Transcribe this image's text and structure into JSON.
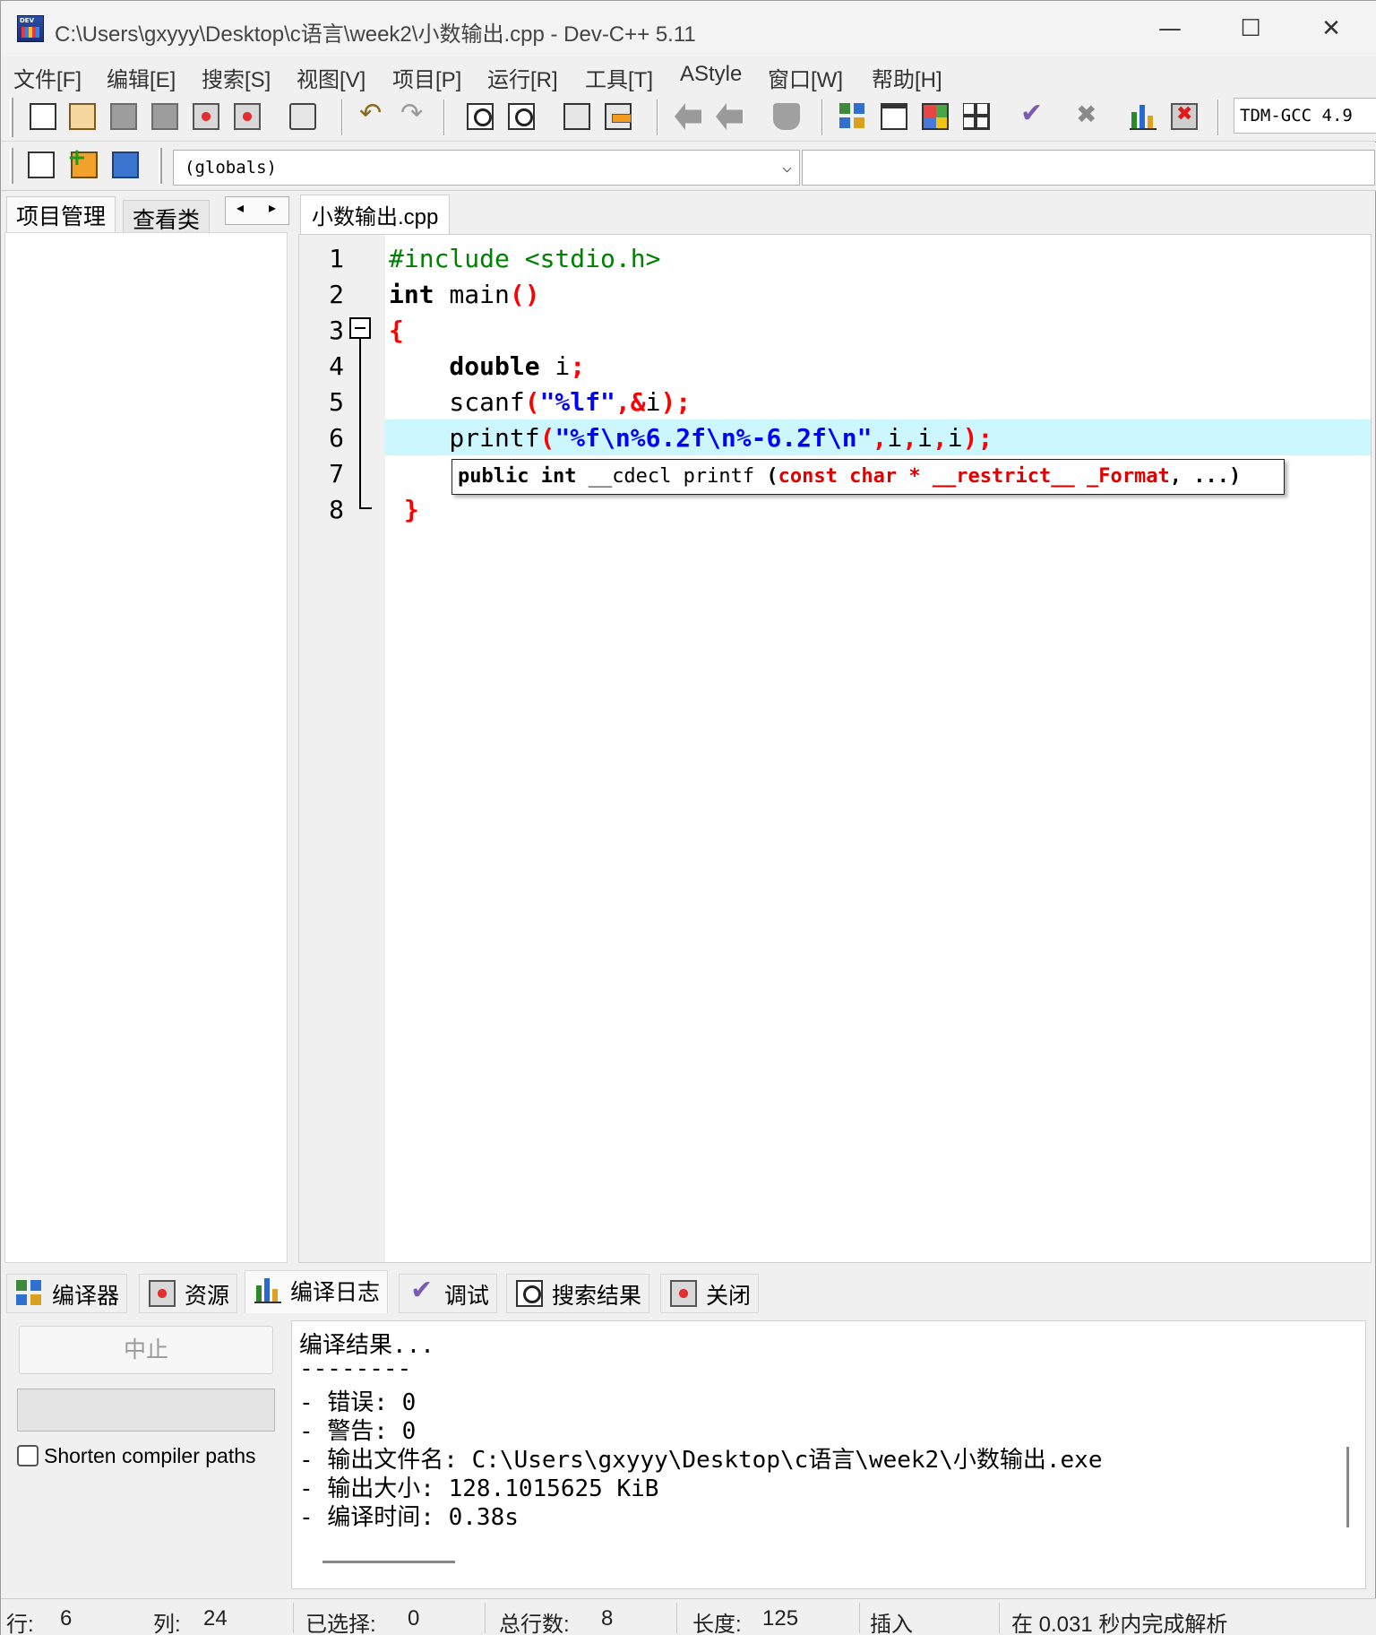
{
  "window": {
    "title": "C:\\Users\\gxyyy\\Desktop\\c语言\\week2\\小数输出.cpp - Dev-C++ 5.11",
    "minimize": "—",
    "maximize": "☐",
    "close": "✕"
  },
  "menu": [
    "文件[F]",
    "编辑[E]",
    "搜索[S]",
    "视图[V]",
    "项目[P]",
    "运行[R]",
    "工具[T]",
    "AStyle",
    "窗口[W]",
    "帮助[H]"
  ],
  "toolbar": {
    "compiler": "TDM-GCC 4.9",
    "globals": "(globals)",
    "combo_arrow": "⌵"
  },
  "left_tabs": [
    "项目管理",
    "查看类"
  ],
  "nav": {
    "prev": "◂",
    "next": "▸"
  },
  "editor": {
    "file_tab": "小数输出.cpp",
    "line_numbers": [
      "1",
      "2",
      "3",
      "4",
      "5",
      "6",
      "7",
      "8"
    ],
    "lines": {
      "l1": "#include <stdio.h>",
      "l2_kw": "int",
      "l2_id": " main",
      "l2_sym": "()",
      "l3_sym": "{",
      "l4_kw": "    double",
      "l4_id": " i",
      "l4_sym": ";",
      "l5_id": "    scanf",
      "l5_sym1": "(",
      "l5_str": "\"%lf\"",
      "l5_sym2": ",&",
      "l5_id2": "i",
      "l5_sym3": ");",
      "l6_id": "    printf",
      "l6_sym1": "(",
      "l6_str": "\"%f\\n%6.2f\\n%-6.2f\\n\"",
      "l6_sym2": ",",
      "l6_id2": "i",
      "l6_sym3": ",",
      "l6_id3": "i",
      "l6_sym4": ",",
      "l6_id4": "i",
      "l6_sym5": ");",
      "l8_sym": " }"
    },
    "tooltip": {
      "kw1": "public int",
      "plain1": " __cdecl printf ",
      "paren1": "(",
      "red1": "const char * __restrict__ _Format",
      "rest": ", ...)"
    }
  },
  "bottom_tabs": [
    "编译器",
    "资源",
    "编译日志",
    "调试",
    "搜索结果",
    "关闭"
  ],
  "bottom_panel": {
    "stop_button": "中止",
    "shorten_label": "Shorten compiler paths",
    "log_lines": [
      "编译结果...",
      "--------",
      "- 错误: 0",
      "- 警告: 0",
      "- 输出文件名: C:\\Users\\gxyyy\\Desktop\\c语言\\week2\\小数输出.exe",
      "- 输出大小: 128.1015625 KiB",
      "- 编译时间: 0.38s"
    ]
  },
  "status": {
    "row_label": "行:",
    "row_value": "6",
    "col_label": "列:",
    "col_value": "24",
    "sel_label": "已选择:",
    "sel_value": "0",
    "total_label": "总行数:",
    "total_value": "8",
    "len_label": "长度:",
    "len_value": "125",
    "mode": "插入",
    "parse": "在 0.031 秒内完成解析"
  }
}
